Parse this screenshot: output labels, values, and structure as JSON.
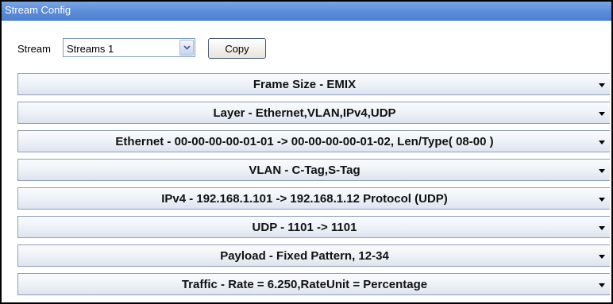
{
  "window": {
    "title": "Stream Config"
  },
  "stream": {
    "label": "Stream",
    "selected": "Streams 1",
    "copy_label": "Copy"
  },
  "sections": [
    {
      "title": "Frame Size - EMIX"
    },
    {
      "title": "Layer - Ethernet,VLAN,IPv4,UDP"
    },
    {
      "title": "Ethernet - 00-00-00-00-01-01 -> 00-00-00-00-01-02, Len/Type( 08-00 )"
    },
    {
      "title": "VLAN - C-Tag,S-Tag"
    },
    {
      "title": "IPv4 - 192.168.1.101 -> 192.168.1.12 Protocol (UDP)"
    },
    {
      "title": "UDP - 1101 -> 1101"
    },
    {
      "title": "Payload - Fixed Pattern, 12-34"
    },
    {
      "title": "Traffic - Rate = 6.250,RateUnit = Percentage"
    }
  ]
}
